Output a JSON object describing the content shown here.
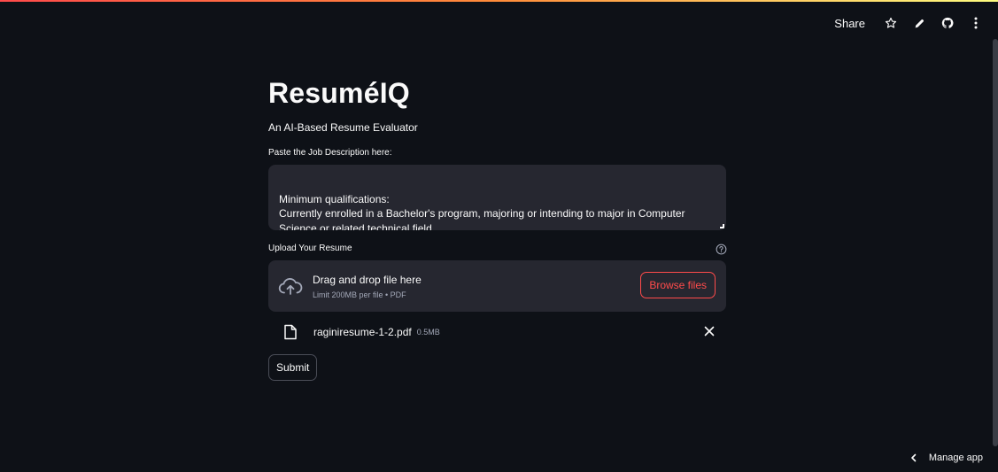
{
  "toolbar": {
    "share_label": "Share",
    "icons": [
      "star-icon",
      "pencil-icon",
      "github-icon",
      "kebab-menu-icon"
    ]
  },
  "app": {
    "title": "ResuméIQ",
    "subtitle": "An AI-Based Resume Evaluator"
  },
  "job_description": {
    "label": "Paste the Job Description here:",
    "value": "Minimum qualifications:\nCurrently enrolled in a Bachelor's program, majoring or intending to major in Computer Science or related technical field.\nExperience in one or more general purpose programming languages."
  },
  "upload": {
    "label": "Upload Your Resume",
    "drop_title": "Drag and drop file here",
    "drop_subtitle": "Limit 200MB per file • PDF",
    "browse_label": "Browse files",
    "file_name": "raginiresume-1-2.pdf",
    "file_size": "0.5MB"
  },
  "submit_label": "Submit",
  "footer": {
    "manage_app_label": "Manage app"
  },
  "colors": {
    "background": "#0e1117",
    "input_background": "#262730",
    "accent": "#ff4b4b"
  }
}
